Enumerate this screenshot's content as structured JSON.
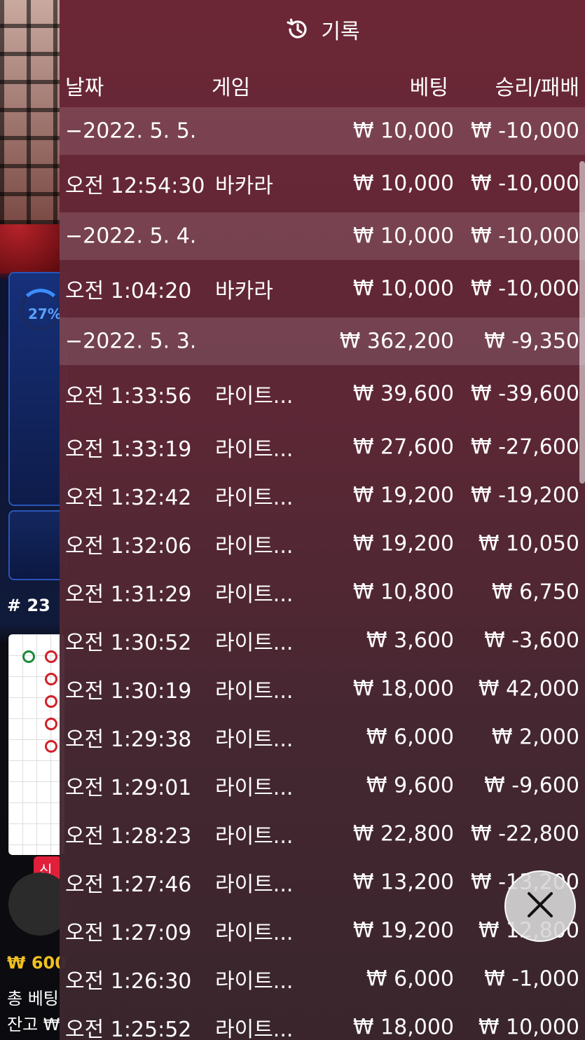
{
  "background": {
    "progress_label": "27%",
    "round_label": "# 23",
    "badge_label": "신규",
    "money": "₩ 600",
    "total_bet": "총 베팅",
    "balance": "잔고 ₩"
  },
  "header": {
    "title": "기록",
    "icon": "history-icon"
  },
  "columns": {
    "date": "날짜",
    "game": "게임",
    "bet": "베팅",
    "winloss": "승리/패배"
  },
  "rows": [
    {
      "type": "group",
      "date": "−2022. 5. 5.",
      "game": "",
      "bet": "₩ 10,000",
      "win": "₩ -10,000"
    },
    {
      "type": "item",
      "date": "오전 12:54:30",
      "game": "바카라",
      "bet": "₩ 10,000",
      "win": "₩ -10,000"
    },
    {
      "type": "group",
      "date": "−2022. 5. 4.",
      "game": "",
      "bet": "₩ 10,000",
      "win": "₩ -10,000"
    },
    {
      "type": "item",
      "date": "오전 1:04:20",
      "game": "바카라",
      "bet": "₩ 10,000",
      "win": "₩ -10,000"
    },
    {
      "type": "group",
      "date": "−2022. 5. 3.",
      "game": "",
      "bet": "₩ 362,200",
      "win": "₩ -9,350"
    },
    {
      "type": "item",
      "date": "오전 1:33:56",
      "game": "라이트...",
      "bet": "₩ 39,600",
      "win": "₩ -39,600"
    },
    {
      "type": "item",
      "date": "오전 1:33:19",
      "game": "라이트...",
      "bet": "₩ 27,600",
      "win": "₩ -27,600"
    },
    {
      "type": "item",
      "date": "오전 1:32:42",
      "game": "라이트...",
      "bet": "₩ 19,200",
      "win": "₩ -19,200"
    },
    {
      "type": "item",
      "date": "오전 1:32:06",
      "game": "라이트...",
      "bet": "₩ 19,200",
      "win": "₩ 10,050"
    },
    {
      "type": "item",
      "date": "오전 1:31:29",
      "game": "라이트...",
      "bet": "₩ 10,800",
      "win": "₩ 6,750"
    },
    {
      "type": "item",
      "date": "오전 1:30:52",
      "game": "라이트...",
      "bet": "₩ 3,600",
      "win": "₩ -3,600"
    },
    {
      "type": "item",
      "date": "오전 1:30:19",
      "game": "라이트...",
      "bet": "₩ 18,000",
      "win": "₩ 42,000"
    },
    {
      "type": "item",
      "date": "오전 1:29:38",
      "game": "라이트...",
      "bet": "₩ 6,000",
      "win": "₩ 2,000"
    },
    {
      "type": "item",
      "date": "오전 1:29:01",
      "game": "라이트...",
      "bet": "₩ 9,600",
      "win": "₩ -9,600"
    },
    {
      "type": "item",
      "date": "오전 1:28:23",
      "game": "라이트...",
      "bet": "₩ 22,800",
      "win": "₩ -22,800"
    },
    {
      "type": "item",
      "date": "오전 1:27:46",
      "game": "라이트...",
      "bet": "₩ 13,200",
      "win": "₩ -13,200"
    },
    {
      "type": "item",
      "date": "오전 1:27:09",
      "game": "라이트...",
      "bet": "₩ 19,200",
      "win": "₩ 12,800"
    },
    {
      "type": "item",
      "date": "오전 1:26:30",
      "game": "라이트...",
      "bet": "₩ 6,000",
      "win": "₩ -1,000"
    },
    {
      "type": "item",
      "date": "오전 1:25:52",
      "game": "라이트...",
      "bet": "₩ 18,000",
      "win": "₩ 10,000"
    }
  ],
  "close_button": {
    "icon": "close-icon"
  }
}
